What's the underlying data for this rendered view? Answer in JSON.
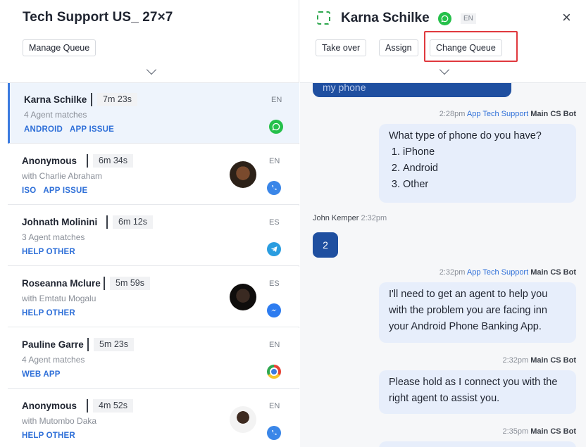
{
  "queue": {
    "title": "Tech Support US_ 27×7",
    "manage_label": "Manage Queue"
  },
  "conversations": [
    {
      "name": "Karna Schilke",
      "timer": "7m 23s",
      "sub": "4 Agent matches",
      "tags": [
        "ANDROID",
        "APP ISSUE"
      ],
      "lang": "EN",
      "channel": "whatsapp-icon"
    },
    {
      "name": "Anonymous",
      "timer": "6m 34s",
      "sub": "with Charlie Abraham",
      "tags": [
        "ISO",
        "APP ISSUE"
      ],
      "lang": "EN",
      "channel": "viber-icon"
    },
    {
      "name": "Johnath Molinini",
      "timer": "6m 12s",
      "sub": "3 Agent matches",
      "tags": [
        "HELP OTHER"
      ],
      "lang": "ES",
      "channel": "telegram-icon"
    },
    {
      "name": "Roseanna Mclure",
      "timer": "5m 59s",
      "sub": "with Emtatu Mogalu",
      "tags": [
        "HELP OTHER"
      ],
      "lang": "ES",
      "channel": "messenger-icon"
    },
    {
      "name": "Pauline Garre",
      "timer": "5m 23s",
      "sub": "4 Agent matches",
      "tags": [
        "WEB APP"
      ],
      "lang": "EN",
      "channel": "chrome-icon"
    },
    {
      "name": "Anonymous",
      "timer": "4m 52s",
      "sub": "with Mutombo Daka",
      "tags": [
        "HELP OTHER"
      ],
      "lang": "EN",
      "channel": "viber-icon"
    }
  ],
  "detail": {
    "name": "Karna Schilke",
    "lang": "EN",
    "close": "×",
    "take_over": "Take over",
    "assign": "Assign",
    "change_queue": "Change Queue"
  },
  "chat": {
    "top_bubble": "my phone",
    "m1": {
      "time": "2:28pm",
      "source": "App Tech Support",
      "sender": "Main CS Bot",
      "text": "What type of phone do you have?",
      "options": [
        "iPhone",
        "Android",
        "Other"
      ]
    },
    "u1": {
      "sender": "John Kemper",
      "time": "2:32pm",
      "text": "2"
    },
    "m2": {
      "time": "2:32pm",
      "source": "App Tech Support",
      "sender": "Main CS Bot",
      "text": "I'll need to get an agent to help you with the problem you are facing inn your Android Phone Banking App."
    },
    "m3": {
      "time": "2:32pm",
      "sender": "Main CS Bot",
      "text": "Please hold as I connect you with the right agent to assist you."
    },
    "m4": {
      "time": "2:35pm",
      "sender": "Main CS Bot"
    }
  },
  "colors": {
    "accent": "#2e6fd8",
    "highlight": "#e0393e",
    "user_bubble": "#1f4fa0",
    "bot_bubble": "#e7eefb"
  }
}
